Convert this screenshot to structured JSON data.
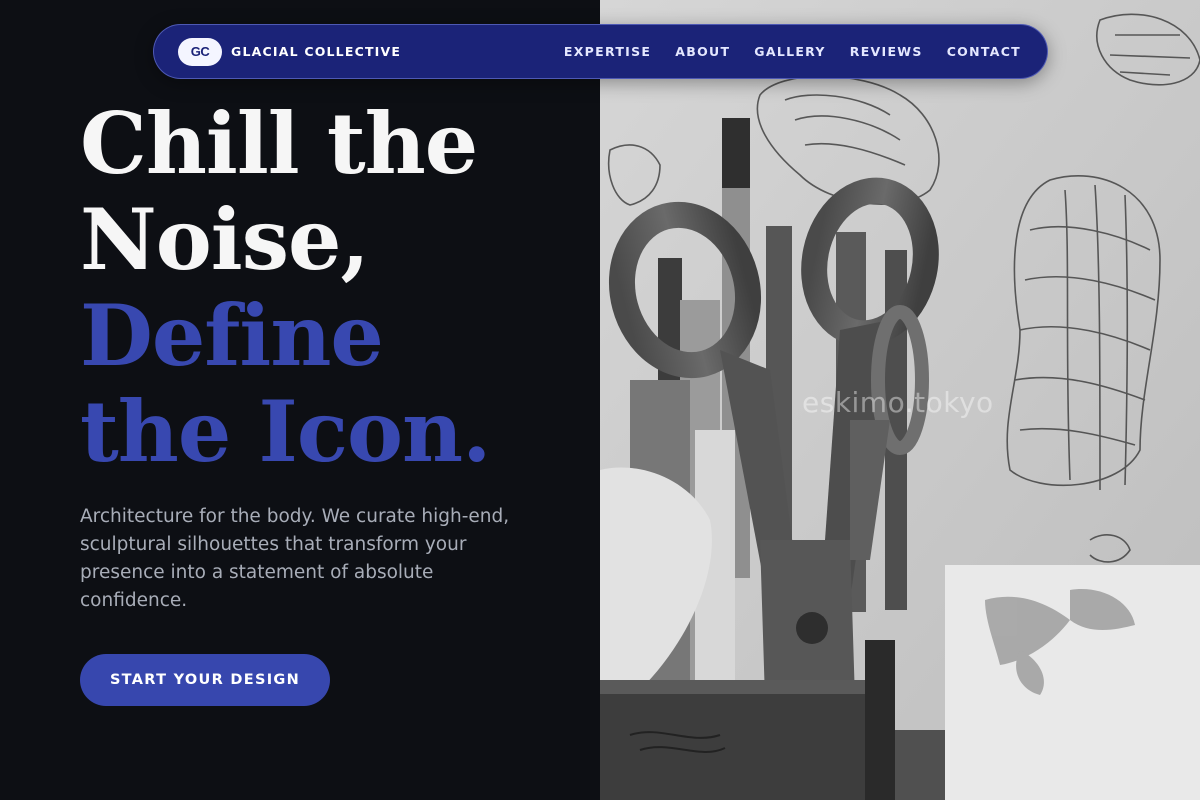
{
  "nav": {
    "logo_text": "GC",
    "brand_name": "GLACIAL COLLECTIVE",
    "links": [
      "EXPERTISE",
      "ABOUT",
      "GALLERY",
      "REVIEWS",
      "CONTACT"
    ]
  },
  "hero": {
    "title_line1": "Chill the",
    "title_line2": "Noise,",
    "title_line3": "Define",
    "title_line4": "the Icon.",
    "description": "Architecture for the body. We curate high-end, sculptural silhouettes that transform your presence into a statement of absolute confidence.",
    "cta_label": "START YOUR DESIGN"
  },
  "image": {
    "watermark": "eskimo.tokyo"
  },
  "colors": {
    "background": "#0d0f14",
    "nav": "#1b2378",
    "accent": "#3848b0",
    "cta": "#3747ae"
  }
}
